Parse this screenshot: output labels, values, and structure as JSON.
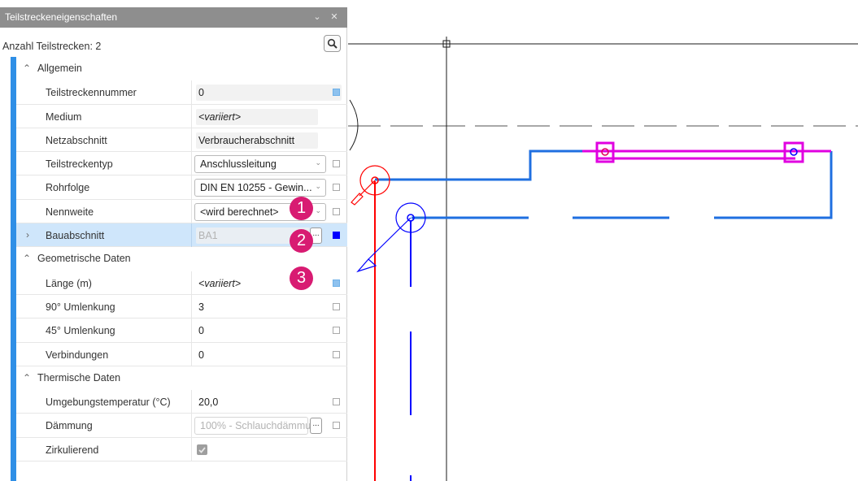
{
  "panel": {
    "title": "Teilstreckeneigenschaften",
    "minimize_icon": "chevron-down-icon",
    "close_icon": "close-icon",
    "count_label": "Anzahl Teilstrecken: 2",
    "search_icon": "search-icon",
    "accent_color": "#2f8fe6",
    "sections": {
      "allgemein": "Allgemein",
      "geometrisch": "Geometrische Daten",
      "thermisch": "Thermische Daten"
    },
    "properties": {
      "teilstreckennummer": {
        "label": "Teilstreckennummer",
        "value": "0"
      },
      "medium": {
        "label": "Medium",
        "value": "<variiert>"
      },
      "netzabschnitt": {
        "label": "Netzabschnitt",
        "value": "Verbraucherabschnitt"
      },
      "teilstreckentyp": {
        "label": "Teilstreckentyp",
        "value": "Anschlussleitung"
      },
      "rohrfolge": {
        "label": "Rohrfolge",
        "value": "DIN EN 10255 - Gewin..."
      },
      "nennweite": {
        "label": "Nennweite",
        "value": "<wird berechnet>"
      },
      "bauabschnitt": {
        "label": "Bauabschnitt",
        "value": "BA1"
      },
      "laenge": {
        "label": "Länge (m)",
        "value": "<variiert>"
      },
      "umlenkung90": {
        "label": "90° Umlenkung",
        "value": "3"
      },
      "umlenkung45": {
        "label": "45° Umlenkung",
        "value": "0"
      },
      "verbindungen": {
        "label": "Verbindungen",
        "value": "0"
      },
      "umgebungstemperatur": {
        "label": "Umgebungstemperatur (°C)",
        "value": "20,0"
      },
      "daemmung": {
        "label": "Dämmung",
        "value": "100% - Schlauchdämmu"
      },
      "zirkulierend": {
        "label": "Zirkulierend",
        "checked": true
      }
    },
    "ellipsis_label": "..."
  },
  "badges": [
    "1",
    "2",
    "3"
  ],
  "badge_color": "#d81b72",
  "drawing": {
    "pipe_blue": "#1f6fe0",
    "pipe_magenta": "#e000e0",
    "pipe_red": "#ff0000",
    "dark_blue": "#0000ff"
  }
}
